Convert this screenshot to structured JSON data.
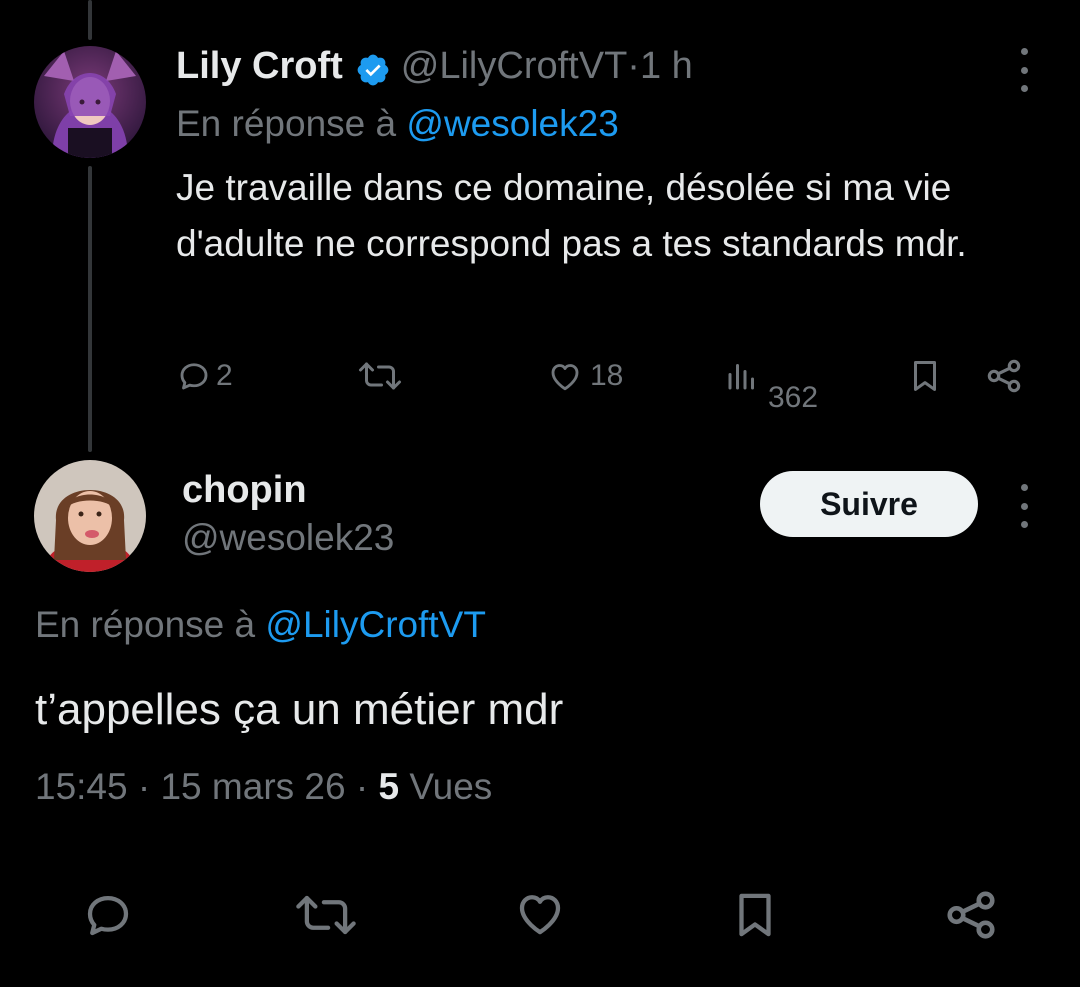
{
  "parent_tweet": {
    "author_name": "Lily Croft",
    "handle": "@LilyCroftVT",
    "separator": " · ",
    "time_ago": "1 h",
    "reply_prefix": "En réponse à ",
    "reply_to": "@wesolek23",
    "text": "Je travaille dans ce domaine, désolée si ma vie d'adulte ne correspond pas a tes standards mdr.",
    "stats": {
      "replies": "2",
      "likes": "18",
      "views": "362"
    }
  },
  "main_tweet": {
    "author_name": "chopin",
    "handle": "@wesolek23",
    "follow_label": "Suivre",
    "reply_prefix": "En réponse à ",
    "reply_to": "@LilyCroftVT",
    "text": "t’appelles ça un métier mdr",
    "time": "15:45",
    "sep1": " · ",
    "date": "15 mars 26",
    "sep2": " · ",
    "views_count": "5",
    "views_label": " Vues"
  },
  "icons": [
    "verified-badge-icon",
    "reply-icon",
    "retweet-icon",
    "like-icon",
    "views-icon",
    "bookmark-icon",
    "share-icon",
    "more-icon"
  ],
  "colors": {
    "background": "#000000",
    "text": "#e7e9ea",
    "muted": "#71767b",
    "link": "#1d9bf0",
    "verified": "#1d9bf0"
  }
}
